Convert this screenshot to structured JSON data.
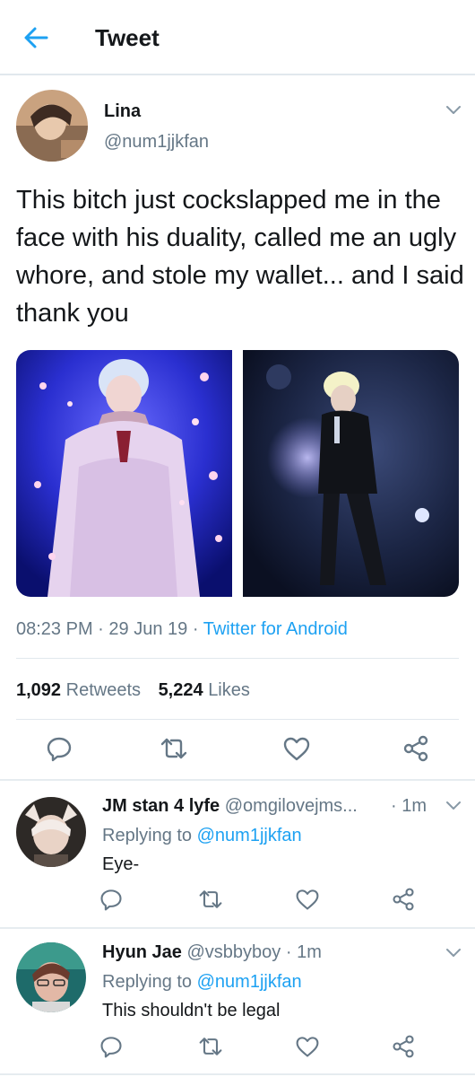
{
  "header": {
    "title": "Tweet"
  },
  "tweet": {
    "name": "Lina",
    "handle": "@num1jjkfan",
    "text": "This bitch just cockslapped me in the face with his duality, called me an ugly whore, and stole my wallet... and I said thank you",
    "time": "08:23 PM",
    "date": "29 Jun 19",
    "source": "Twitter for Android",
    "separator": "·",
    "retweets_count": "1,092",
    "retweets_label": "Retweets",
    "likes_count": "5,224",
    "likes_label": "Likes"
  },
  "replies": [
    {
      "name": "JM stan 4 lyfe",
      "handle": "@omgilovejms...",
      "time": "· 1m",
      "replying_prefix": "Replying to",
      "replying_handle": "@num1jjkfan",
      "text": "Eye-"
    },
    {
      "name": "Hyun Jae",
      "handle": "@vsbbyboy",
      "time": "· 1m",
      "replying_prefix": "Replying to",
      "replying_handle": "@num1jjkfan",
      "text": "This shouldn't be legal"
    }
  ],
  "icons": {
    "back": "arrow-left-icon",
    "more": "chevron-down-icon",
    "reply": "comment-icon",
    "retweet": "retweet-icon",
    "like": "heart-icon",
    "share": "share-icon"
  },
  "colors": {
    "accent": "#1da1f2",
    "secondary_text": "#657786",
    "primary_text": "#14171a",
    "divider": "#e1e8ed"
  }
}
